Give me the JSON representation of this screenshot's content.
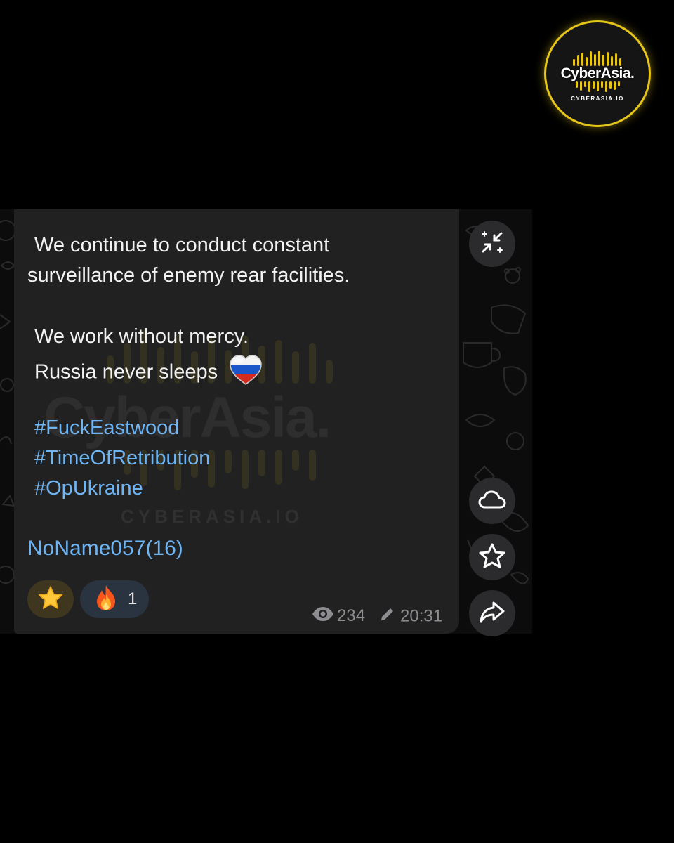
{
  "logo": {
    "title": "CyberAsia.",
    "subtitle": "CYBERASIA.IO",
    "accent_color": "#e6c619"
  },
  "watermark": {
    "title": "CyberAsia.",
    "subtitle": "CYBERASIA.IO"
  },
  "message": {
    "lines": [
      "We continue to conduct constant",
      "surveillance of enemy rear facilities.",
      "We work without mercy.",
      "Russia never sleeps"
    ],
    "heart_emoji": "russian-flag-heart",
    "hashtags": [
      "#FuckEastwood",
      "#TimeOfRetribution",
      "#OpUkraine"
    ],
    "signature": "NoName057(16)",
    "link_color": "#6fb5f4"
  },
  "reactions": [
    {
      "emoji": "star",
      "count": ""
    },
    {
      "emoji": "fire",
      "count": "1"
    }
  ],
  "meta": {
    "views": "234",
    "time": "20:31",
    "views_icon": "eye-icon",
    "edited_icon": "pencil-icon"
  },
  "side_buttons": [
    {
      "icon": "collapse-icon"
    },
    {
      "icon": "cloud-icon"
    },
    {
      "icon": "star-icon"
    },
    {
      "icon": "share-icon"
    }
  ]
}
